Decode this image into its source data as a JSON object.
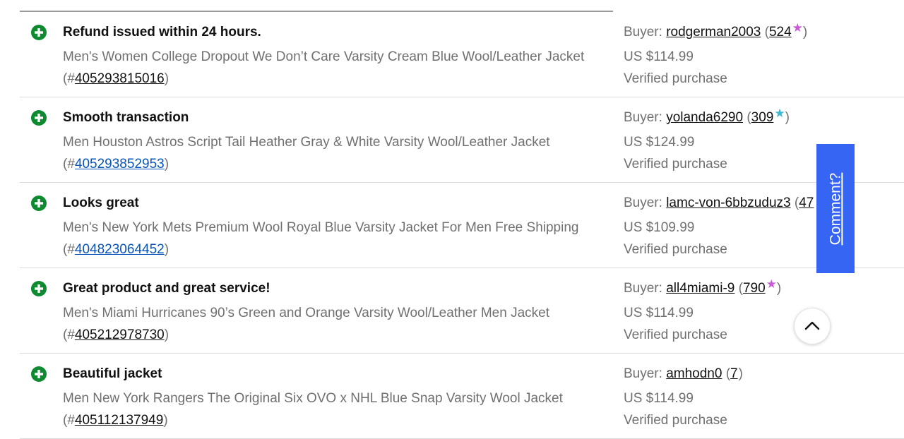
{
  "feedback": [
    {
      "comment": "Refund issued within 24 hours.",
      "item_title": "Men's Women College Dropout We Don’t Care Varsity Cream Blue Wool/Leather Jacket",
      "item_prefix": "(#",
      "item_number": "405293815016",
      "item_suffix": ")",
      "item_link_color": "dark",
      "buyer_label": "Buyer:",
      "buyer_name": "rodgerman2003",
      "score_open": "(",
      "buyer_score": "524",
      "star": "★",
      "star_color": "#c85ad6",
      "score_close": ")",
      "price": "US $114.99",
      "verified": "Verified purchase"
    },
    {
      "comment": "Smooth transaction",
      "item_title": "Men Houston Astros Script Tail Heather Gray & White Varsity Wool/Leather Jacket",
      "item_prefix": "(#",
      "item_number": "405293852953",
      "item_suffix": ")",
      "item_link_color": "blue",
      "buyer_label": "Buyer:",
      "buyer_name": "yolanda6290",
      "score_open": "(",
      "buyer_score": "309",
      "star": "★",
      "star_color": "#3bb8d6",
      "score_close": ")",
      "price": "US $124.99",
      "verified": "Verified purchase"
    },
    {
      "comment": "Looks great",
      "item_title": "Men's New York Mets Premium Wool Royal Blue Varsity Jacket For Men Free Shipping",
      "item_prefix": "(#",
      "item_number": "404823064452",
      "item_suffix": ")",
      "item_link_color": "blue",
      "buyer_label": "Buyer:",
      "buyer_name": "lamc-von-6bbzuduz3",
      "score_open": "(",
      "buyer_score": "47",
      "star": "",
      "star_color": "#3bb8d6",
      "score_close": "",
      "price": "US $109.99",
      "verified": "Verified purchase"
    },
    {
      "comment": "Great product and great service!",
      "item_title": "Men's Miami Hurricanes 90’s Green and Orange Varsity Wool/Leather Men Jacket",
      "item_prefix": "(#",
      "item_number": "405212978730",
      "item_suffix": ")",
      "item_link_color": "dark",
      "buyer_label": "Buyer:",
      "buyer_name": "all4miami-9",
      "score_open": "(",
      "buyer_score": "790",
      "star": "★",
      "star_color": "#c85ad6",
      "score_close": ")",
      "price": "US $114.99",
      "verified": "Verified purchase"
    },
    {
      "comment": "Beautiful jacket",
      "item_title": "Men New York Rangers The Original Six OVO x NHL Blue Snap Varsity Wool Jacket",
      "item_prefix": "(#",
      "item_number": "405112137949",
      "item_suffix": ")",
      "item_link_color": "dark",
      "buyer_label": "Buyer:",
      "buyer_name": "amhodn0",
      "score_open": "(",
      "buyer_score": "7",
      "star": "",
      "star_color": "",
      "score_close": ")",
      "price": "US $114.99",
      "verified": "Verified purchase"
    }
  ],
  "icons": {
    "positive": "plus-circle-icon",
    "back_to_top": "chevron-up-icon"
  },
  "comment_tab": {
    "label": "Comment?"
  },
  "colors": {
    "positive_green": "#0e8a31",
    "comment_tab_bg": "#3665f3",
    "link_blue": "#0654ba"
  }
}
